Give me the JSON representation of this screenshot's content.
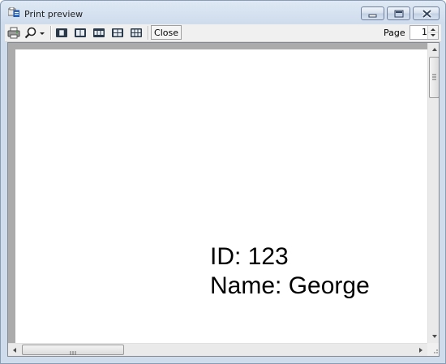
{
  "window": {
    "title": "Print preview",
    "icons": {
      "app": "print-preview-icon",
      "minimize": "minimize-icon",
      "maximize": "maximize-icon",
      "close": "close-icon"
    }
  },
  "toolbar": {
    "tools": [
      {
        "name": "print-icon"
      },
      {
        "name": "zoom-icon"
      },
      {
        "name": "zoom-dropdown-icon"
      },
      {
        "name": "one-page-icon"
      },
      {
        "name": "two-pages-icon"
      },
      {
        "name": "three-pages-icon"
      },
      {
        "name": "four-pages-icon"
      },
      {
        "name": "six-pages-icon"
      }
    ],
    "close_label": "Close",
    "page_label": "Page",
    "page_value": "1"
  },
  "document": {
    "lines": [
      "ID: 123",
      "Name: George"
    ]
  },
  "scrollbars": {
    "vertical_grip": "≡",
    "horizontal_grip": "III"
  },
  "colors": {
    "preview_background": "#ababab",
    "paper": "#ffffff",
    "titlebar": "#dfe9f5"
  }
}
